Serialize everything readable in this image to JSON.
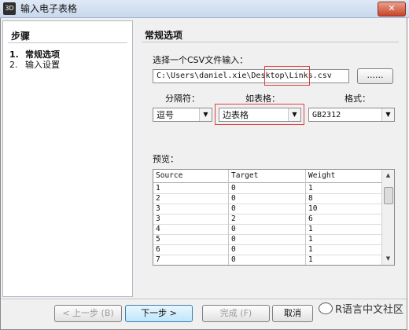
{
  "window": {
    "app_icon": "3D",
    "title": "输入电子表格",
    "close_glyph": "✕"
  },
  "sidebar": {
    "heading": "步骤",
    "steps": [
      {
        "num": "1.",
        "label": "常规选项"
      },
      {
        "num": "2.",
        "label": "输入设置"
      }
    ]
  },
  "main": {
    "heading": "常规选项",
    "file_label": "选择一个CSV文件输入：",
    "file_path": "C:\\Users\\daniel.xie\\Desktop\\Links.csv",
    "browse_label": "......",
    "separator_label": "分隔符：",
    "separator_value": "逗号",
    "table_label": "如表格：",
    "table_value": "边表格",
    "format_label": "格式：",
    "format_value": "GB2312",
    "preview_label": "预览：",
    "preview": {
      "columns": [
        "Source",
        "Target",
        "Weight"
      ],
      "rows": [
        [
          "1",
          "0",
          "1"
        ],
        [
          "2",
          "0",
          "8"
        ],
        [
          "3",
          "0",
          "10"
        ],
        [
          "3",
          "2",
          "6"
        ],
        [
          "4",
          "0",
          "1"
        ],
        [
          "5",
          "0",
          "1"
        ],
        [
          "6",
          "0",
          "1"
        ],
        [
          "7",
          "0",
          "1"
        ]
      ]
    }
  },
  "footer": {
    "back_label": "< 上一步 (B)",
    "next_label": "下一步 >",
    "finish_label": "完成 (F)",
    "cancel_label": "取消"
  },
  "watermark": "R语言中文社区",
  "colors": {
    "highlight": "#e04040",
    "accent": "#3c7fb1"
  }
}
